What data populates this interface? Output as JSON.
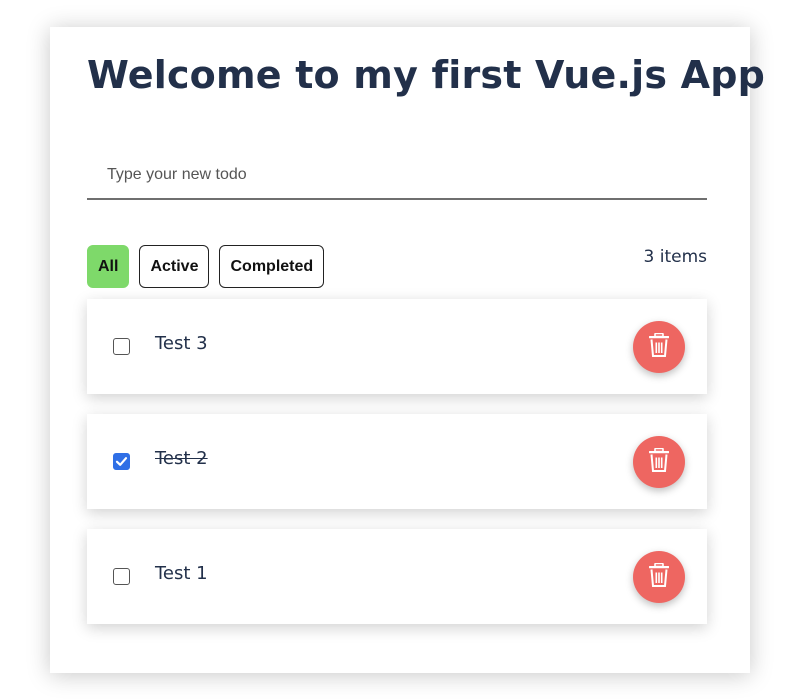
{
  "header": {
    "title": "Welcome to my first Vue.js App"
  },
  "new_todo": {
    "placeholder": "Type your new todo",
    "value": ""
  },
  "filters": {
    "all_label": "All",
    "active_label": "Active",
    "completed_label": "Completed",
    "selected": "All"
  },
  "count_label": "3 items",
  "todos": [
    {
      "text": "Test 3",
      "completed": false
    },
    {
      "text": "Test 2",
      "completed": true
    },
    {
      "text": "Test 1",
      "completed": false
    }
  ],
  "colors": {
    "title": "#22304a",
    "filter_active": "#7ed96a",
    "delete_button": "#ee6661",
    "checkbox_checked": "#2f6fe6"
  },
  "icons": {
    "delete": "trash-icon",
    "check": "checkmark-icon"
  }
}
